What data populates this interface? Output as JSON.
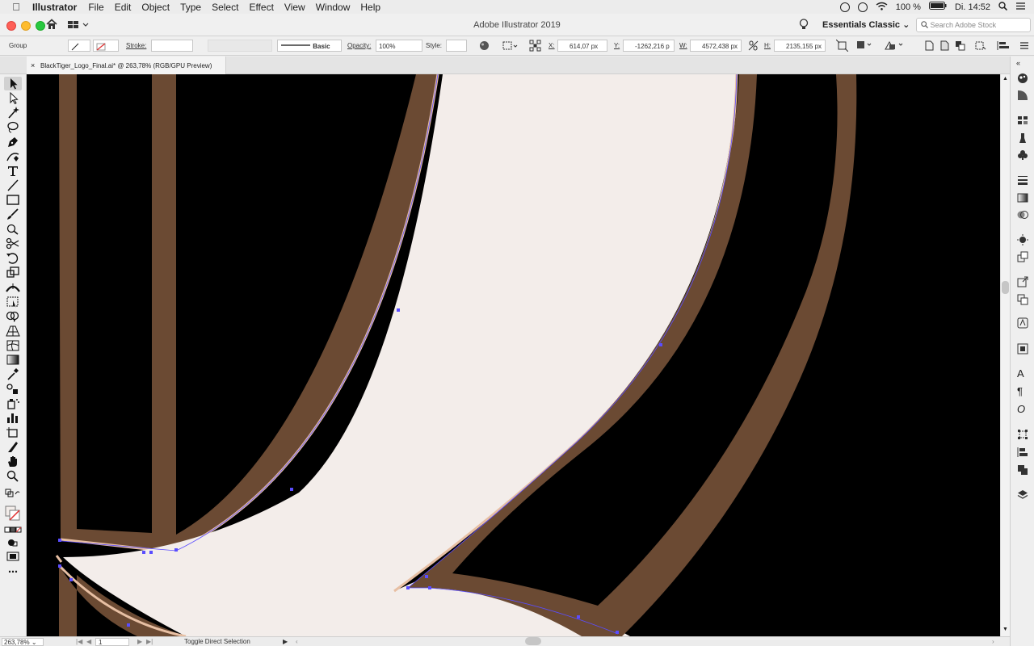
{
  "menubar": {
    "app_name": "Illustrator",
    "items": [
      "File",
      "Edit",
      "Object",
      "Type",
      "Select",
      "Effect",
      "View",
      "Window",
      "Help"
    ],
    "battery": "100 %",
    "clock": "Di. 14:52"
  },
  "titlebar": {
    "title": "Adobe Illustrator 2019",
    "workspace": "Essentials Classic",
    "search_placeholder": "Search Adobe Stock"
  },
  "controlbar": {
    "selection_type": "Group",
    "stroke_label": "Stroke:",
    "brush_label": "Basic",
    "opacity_label": "Opacity:",
    "opacity_value": "100%",
    "style_label": "Style:",
    "x_label": "X:",
    "x_value": "614,07 px",
    "y_label": "Y:",
    "y_value": "-1262,216 p",
    "w_label": "W:",
    "w_value": "4572,438 px",
    "h_label": "H:",
    "h_value": "2135,155 px"
  },
  "document": {
    "tab_title": "BlackTiger_Logo_Final.ai* @ 263,78% (RGB/GPU Preview)"
  },
  "statusbar": {
    "zoom": "263,78%",
    "artboard": "1",
    "tool_hint": "Toggle Direct Selection"
  },
  "colors": {
    "artwork_outline": "#6b4a33",
    "artwork_fill": "#f3edea",
    "selection_halo": "#e7bfa3",
    "anchor_point": "#5a4dff",
    "canvas": "#000000"
  }
}
